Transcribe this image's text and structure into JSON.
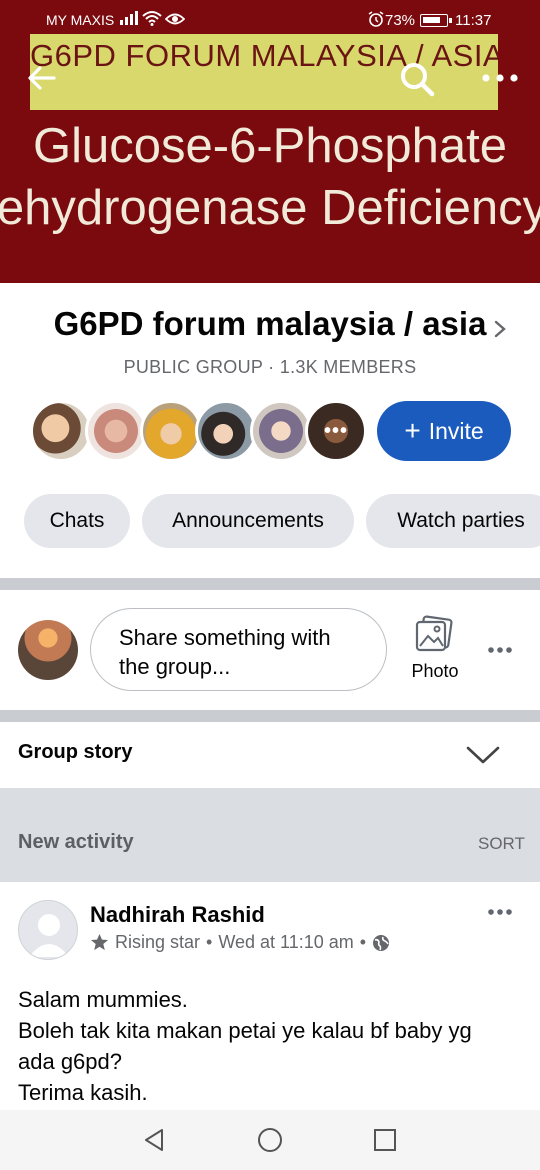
{
  "status_bar": {
    "carrier": "MY MAXIS",
    "battery": "73%",
    "time": "11:37"
  },
  "cover": {
    "banner_text": "G6PD FORUM MALAYSIA / ASIA",
    "line1": "Glucose-6-Phosphate",
    "line2": "ehydrogenase Deficiency",
    "colors": {
      "background": "#7a0a0e",
      "band": "#d9d86c",
      "text": "#f1ead9"
    }
  },
  "header": {
    "back_icon": "arrow-left-icon",
    "search_icon": "search-icon",
    "more_icon": "more-horizontal-icon"
  },
  "group": {
    "name": "G6PD forum malaysia / asia",
    "meta": "PUBLIC GROUP · 1.3K MEMBERS",
    "more_members_label": "•••",
    "invite_label": "Invite",
    "invite_plus": "+",
    "accent": "#1b5bbd"
  },
  "chips": [
    "Chats",
    "Announcements",
    "Watch parties"
  ],
  "composer": {
    "placeholder_line1": "Share something with",
    "placeholder_line2": "the group...",
    "photo_label": "Photo"
  },
  "group_story": {
    "label": "Group story"
  },
  "activity": {
    "label": "New activity",
    "sort_label": "SORT"
  },
  "post": {
    "author": "Nadhirah Rashid",
    "badge": "Rising star",
    "separator": "•",
    "time": "Wed at 11:10 am",
    "lines": [
      "Salam mummies.",
      "Boleh tak kita makan petai ye kalau bf baby yg",
      "ada g6pd?",
      "Terima kasih."
    ]
  }
}
